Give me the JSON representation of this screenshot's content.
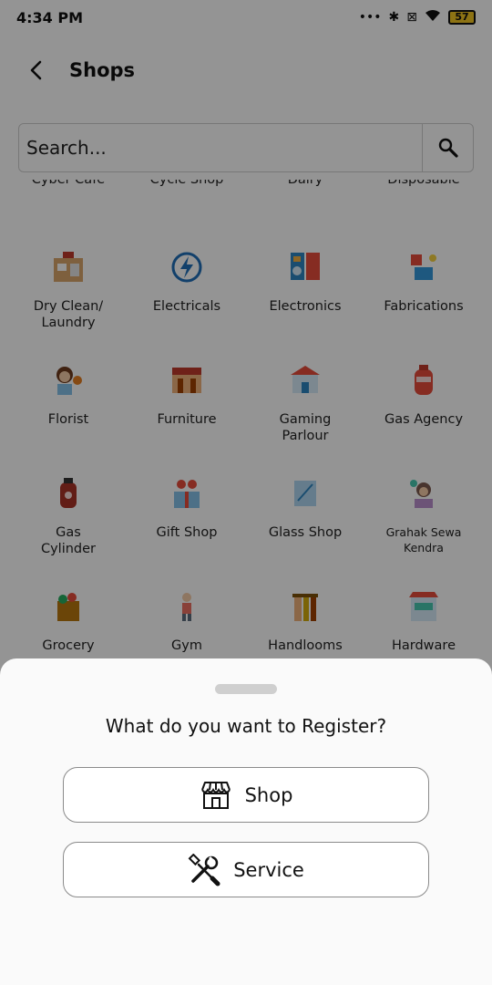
{
  "status_bar": {
    "time": "4:34 PM",
    "battery": "57"
  },
  "header": {
    "title": "Shops"
  },
  "search": {
    "placeholder": "Search..."
  },
  "partial_row": [
    "Cyber Cafe",
    "Cycle Shop",
    "Dairy",
    "Disposable"
  ],
  "categories": [
    {
      "label": "Dry Clean/\nLaundry",
      "icon": "dry-clean-icon"
    },
    {
      "label": "Electricals",
      "icon": "electricals-icon"
    },
    {
      "label": "Electronics",
      "icon": "electronics-icon"
    },
    {
      "label": "Fabrications",
      "icon": "fabrications-icon"
    },
    {
      "label": "Florist",
      "icon": "florist-icon"
    },
    {
      "label": "Furniture",
      "icon": "furniture-icon"
    },
    {
      "label": "Gaming\nParlour",
      "icon": "gaming-parlour-icon"
    },
    {
      "label": "Gas Agency",
      "icon": "gas-agency-icon"
    },
    {
      "label": "Gas\nCylinder",
      "icon": "gas-cylinder-icon"
    },
    {
      "label": "Gift Shop",
      "icon": "gift-shop-icon"
    },
    {
      "label": "Glass Shop",
      "icon": "glass-shop-icon"
    },
    {
      "label": "Grahak Sewa\nKendra",
      "icon": "grahak-sewa-icon"
    },
    {
      "label": "Grocery",
      "icon": "grocery-icon"
    },
    {
      "label": "Gym",
      "icon": "gym-icon"
    },
    {
      "label": "Handlooms",
      "icon": "handlooms-icon"
    },
    {
      "label": "Hardware",
      "icon": "hardware-icon"
    }
  ],
  "sheet": {
    "title": "What do you want to Register?",
    "options": [
      {
        "label": "Shop",
        "icon": "storefront-icon"
      },
      {
        "label": "Service",
        "icon": "tools-icon"
      }
    ]
  }
}
